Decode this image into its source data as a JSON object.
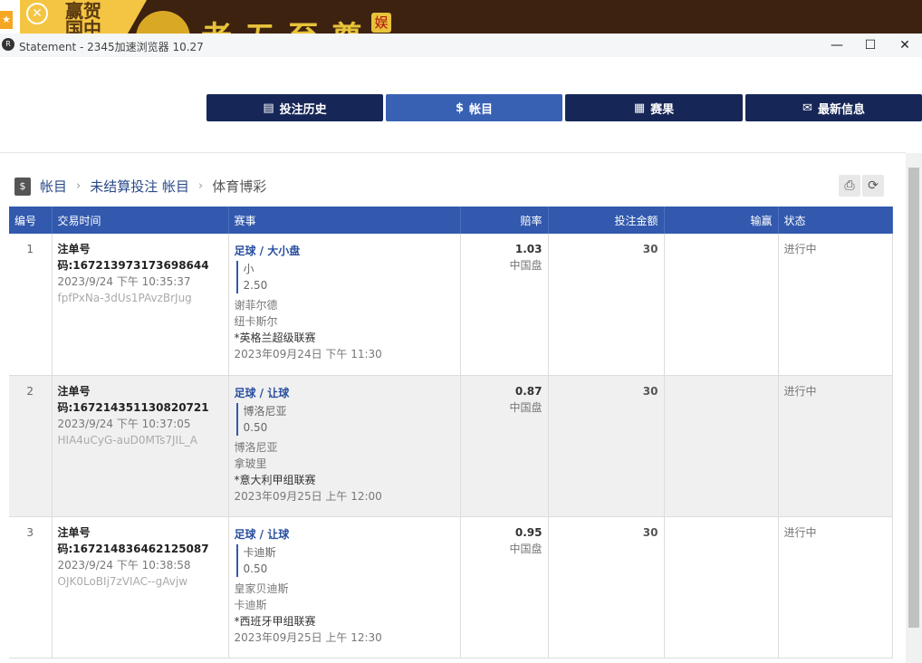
{
  "ad": {
    "text1": "赢贺国中",
    "big": "老五至尊",
    "badge": "娱"
  },
  "window": {
    "title": "Statement - 2345加速浏览器 10.27"
  },
  "nav": [
    {
      "label": "投注历史",
      "icon": "clipboard-icon"
    },
    {
      "label": "帐目",
      "icon": "dollar-doc-icon"
    },
    {
      "label": "赛果",
      "icon": "scoreboard-icon"
    },
    {
      "label": "最新信息",
      "icon": "mail-icon"
    }
  ],
  "breadcrumb": [
    "帐目",
    "未结算投注 帐目",
    "体育博彩"
  ],
  "columns": [
    "编号",
    "交易时间",
    "赛事",
    "赔率",
    "投注金额",
    "输赢",
    "状态"
  ],
  "rows": [
    {
      "no": "1",
      "order": "注单号码:167213973173698644",
      "time": "2023/9/24 下午 10:35:37",
      "code": "fpfPxNa-3dUs1PAvzBrJug",
      "event": "足球 / 大小盘",
      "pick": "小",
      "line": "2.50",
      "home": "谢菲尔德",
      "away": "纽卡斯尔",
      "league": "*英格兰超级联赛",
      "match_time": "2023年09月24日 下午 11:30",
      "odds": "1.03",
      "odds_type": "中国盘",
      "stake": "30",
      "winloss": "",
      "status": "进行中"
    },
    {
      "no": "2",
      "order": "注单号码:167214351130820721",
      "time": "2023/9/24 下午 10:37:05",
      "code": "HIA4uCyG-auD0MTs7JIL_A",
      "event": "足球 / 让球",
      "pick": "博洛尼亚",
      "line": "0.50",
      "home": "博洛尼亚",
      "away": "拿玻里",
      "league": "*意大利甲组联赛",
      "match_time": "2023年09月25日 上午 12:00",
      "odds": "0.87",
      "odds_type": "中国盘",
      "stake": "30",
      "winloss": "",
      "status": "进行中"
    },
    {
      "no": "3",
      "order": "注单号码:167214836462125087",
      "time": "2023/9/24 下午 10:38:58",
      "code": "OJK0LoBIj7zVIAC--gAvjw",
      "event": "足球 / 让球",
      "pick": "卡迪斯",
      "line": "0.50",
      "home": "皇家贝迪斯",
      "away": "卡迪斯",
      "league": "*西班牙甲组联赛",
      "match_time": "2023年09月25日 上午 12:30",
      "odds": "0.95",
      "odds_type": "中国盘",
      "stake": "30",
      "winloss": "",
      "status": "进行中"
    }
  ]
}
